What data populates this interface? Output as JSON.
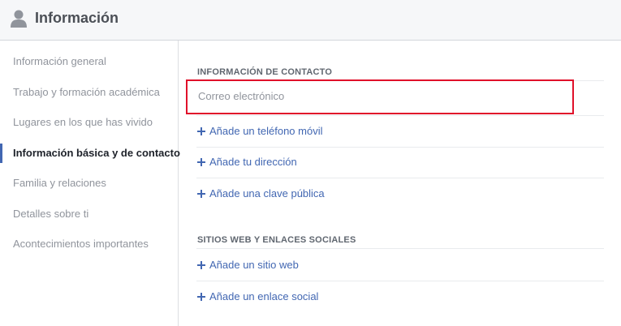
{
  "header": {
    "title": "Información",
    "icon": "user-icon"
  },
  "sidebar": {
    "items": [
      {
        "label": "Información general"
      },
      {
        "label": "Trabajo y formación académica"
      },
      {
        "label": "Lugares en los que has vivido"
      },
      {
        "label": "Información básica y de contacto",
        "active": true
      },
      {
        "label": "Familia y relaciones"
      },
      {
        "label": "Detalles sobre ti"
      },
      {
        "label": "Acontecimientos importantes"
      }
    ]
  },
  "contact": {
    "title": "INFORMACIÓN DE CONTACTO",
    "email_label": "Correo electrónico",
    "links": [
      "Añade un teléfono móvil",
      "Añade tu dirección",
      "Añade una clave pública"
    ]
  },
  "websites": {
    "title": "SITIOS WEB Y ENLACES SOCIALES",
    "links": [
      "Añade un sitio web",
      "Añade un enlace social"
    ]
  },
  "colors": {
    "accent": "#4267b2",
    "highlight_border": "#e0102a",
    "muted_text": "#90949c"
  }
}
